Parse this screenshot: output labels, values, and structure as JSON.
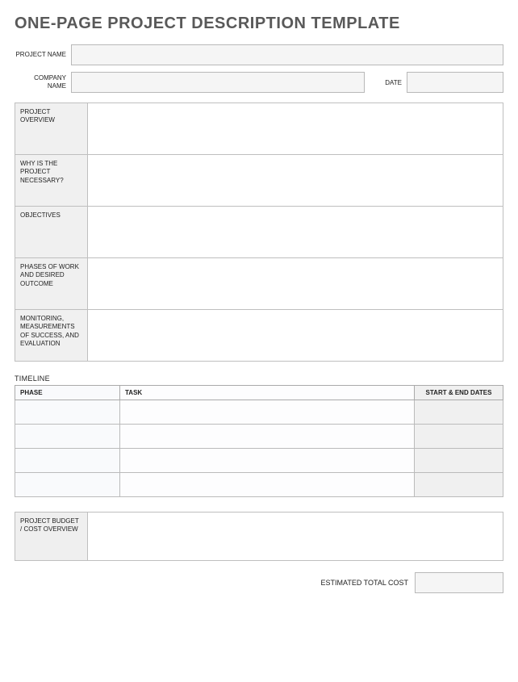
{
  "title": "ONE-PAGE PROJECT DESCRIPTION TEMPLATE",
  "header_form": {
    "project_name_label": "PROJECT NAME",
    "project_name_value": "",
    "company_name_label": "COMPANY NAME",
    "company_name_value": "",
    "date_label": "DATE",
    "date_value": ""
  },
  "sections": [
    {
      "label": "PROJECT OVERVIEW",
      "value": ""
    },
    {
      "label": "WHY IS THE PROJECT NECESSARY?",
      "value": ""
    },
    {
      "label": "OBJECTIVES",
      "value": ""
    },
    {
      "label": "PHASES OF WORK AND DESIRED OUTCOME",
      "value": ""
    },
    {
      "label": "MONITORING, MEASUREMENTS OF SUCCESS, AND EVALUATION",
      "value": ""
    }
  ],
  "timeline": {
    "heading": "TIMELINE",
    "columns": {
      "phase": "PHASE",
      "task": "TASK",
      "dates": "START & END DATES"
    },
    "rows": [
      {
        "phase": "",
        "task": "",
        "dates": ""
      },
      {
        "phase": "",
        "task": "",
        "dates": ""
      },
      {
        "phase": "",
        "task": "",
        "dates": ""
      },
      {
        "phase": "",
        "task": "",
        "dates": ""
      }
    ]
  },
  "budget": {
    "label": "PROJECT BUDGET / COST OVERVIEW",
    "value": ""
  },
  "total": {
    "label": "ESTIMATED TOTAL COST",
    "value": ""
  }
}
